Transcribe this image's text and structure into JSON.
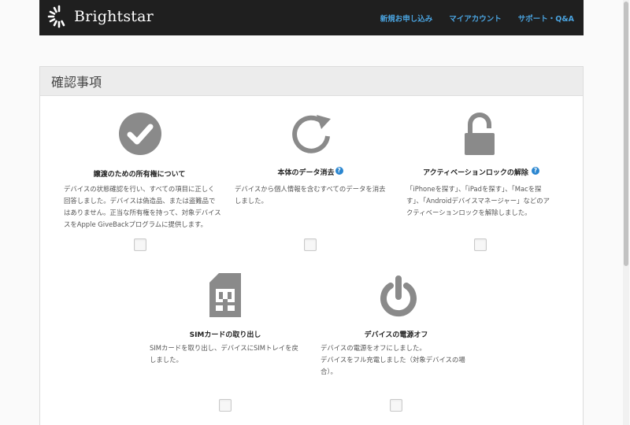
{
  "brand": {
    "name": "Brightstar"
  },
  "nav": {
    "items": [
      "新規お申し込み",
      "マイアカウント",
      "サポート・Q&A"
    ]
  },
  "panel": {
    "title": "確認事項"
  },
  "items": [
    {
      "icon": "checkmark-circle-icon",
      "title": "譲渡のための所有権について",
      "help": false,
      "desc": [
        "デバイスの状態確認を行い、すべての項目に正しく",
        "回答しました。デバイスは偽造品、または盗難品で",
        "はありません。正当な所有権を持って、対象デバイス",
        "スをApple GiveBackプログラムに提供します。"
      ],
      "checked": false
    },
    {
      "icon": "refresh-icon",
      "title": "本体のデータ消去",
      "help": true,
      "desc": [
        "デバイスから個人情報を含むすべてのデータを消去",
        "しました。"
      ],
      "checked": false
    },
    {
      "icon": "unlocked-padlock-icon",
      "title": "アクティベーションロックの解除",
      "help": true,
      "desc": [
        "「iPhoneを探す」、「iPadを探す」、「Macを探",
        "す」、「Androidデバイスマネージャー」などのア",
        "クティベーションロックを解除しました。"
      ],
      "checked": false
    },
    {
      "icon": "sim-card-icon",
      "title": "SIMカードの取り出し",
      "help": false,
      "desc": [
        "SIMカードを取り出し、デバイスにSIMトレイを戻",
        "しました。"
      ],
      "checked": false
    },
    {
      "icon": "power-icon",
      "title": "デバイスの電源オフ",
      "help": false,
      "desc": [
        "デバイスの電源をオフにしました。",
        "デバイスをフル充電しました（対象デバイスの場",
        "合）。"
      ],
      "checked": false
    }
  ],
  "help_glyph": "?",
  "colors": {
    "icon_gray": "#8a8a8a",
    "link_blue": "#4aa3df",
    "help_blue": "#2a86d0",
    "header_bg": "#1f1f1f"
  }
}
